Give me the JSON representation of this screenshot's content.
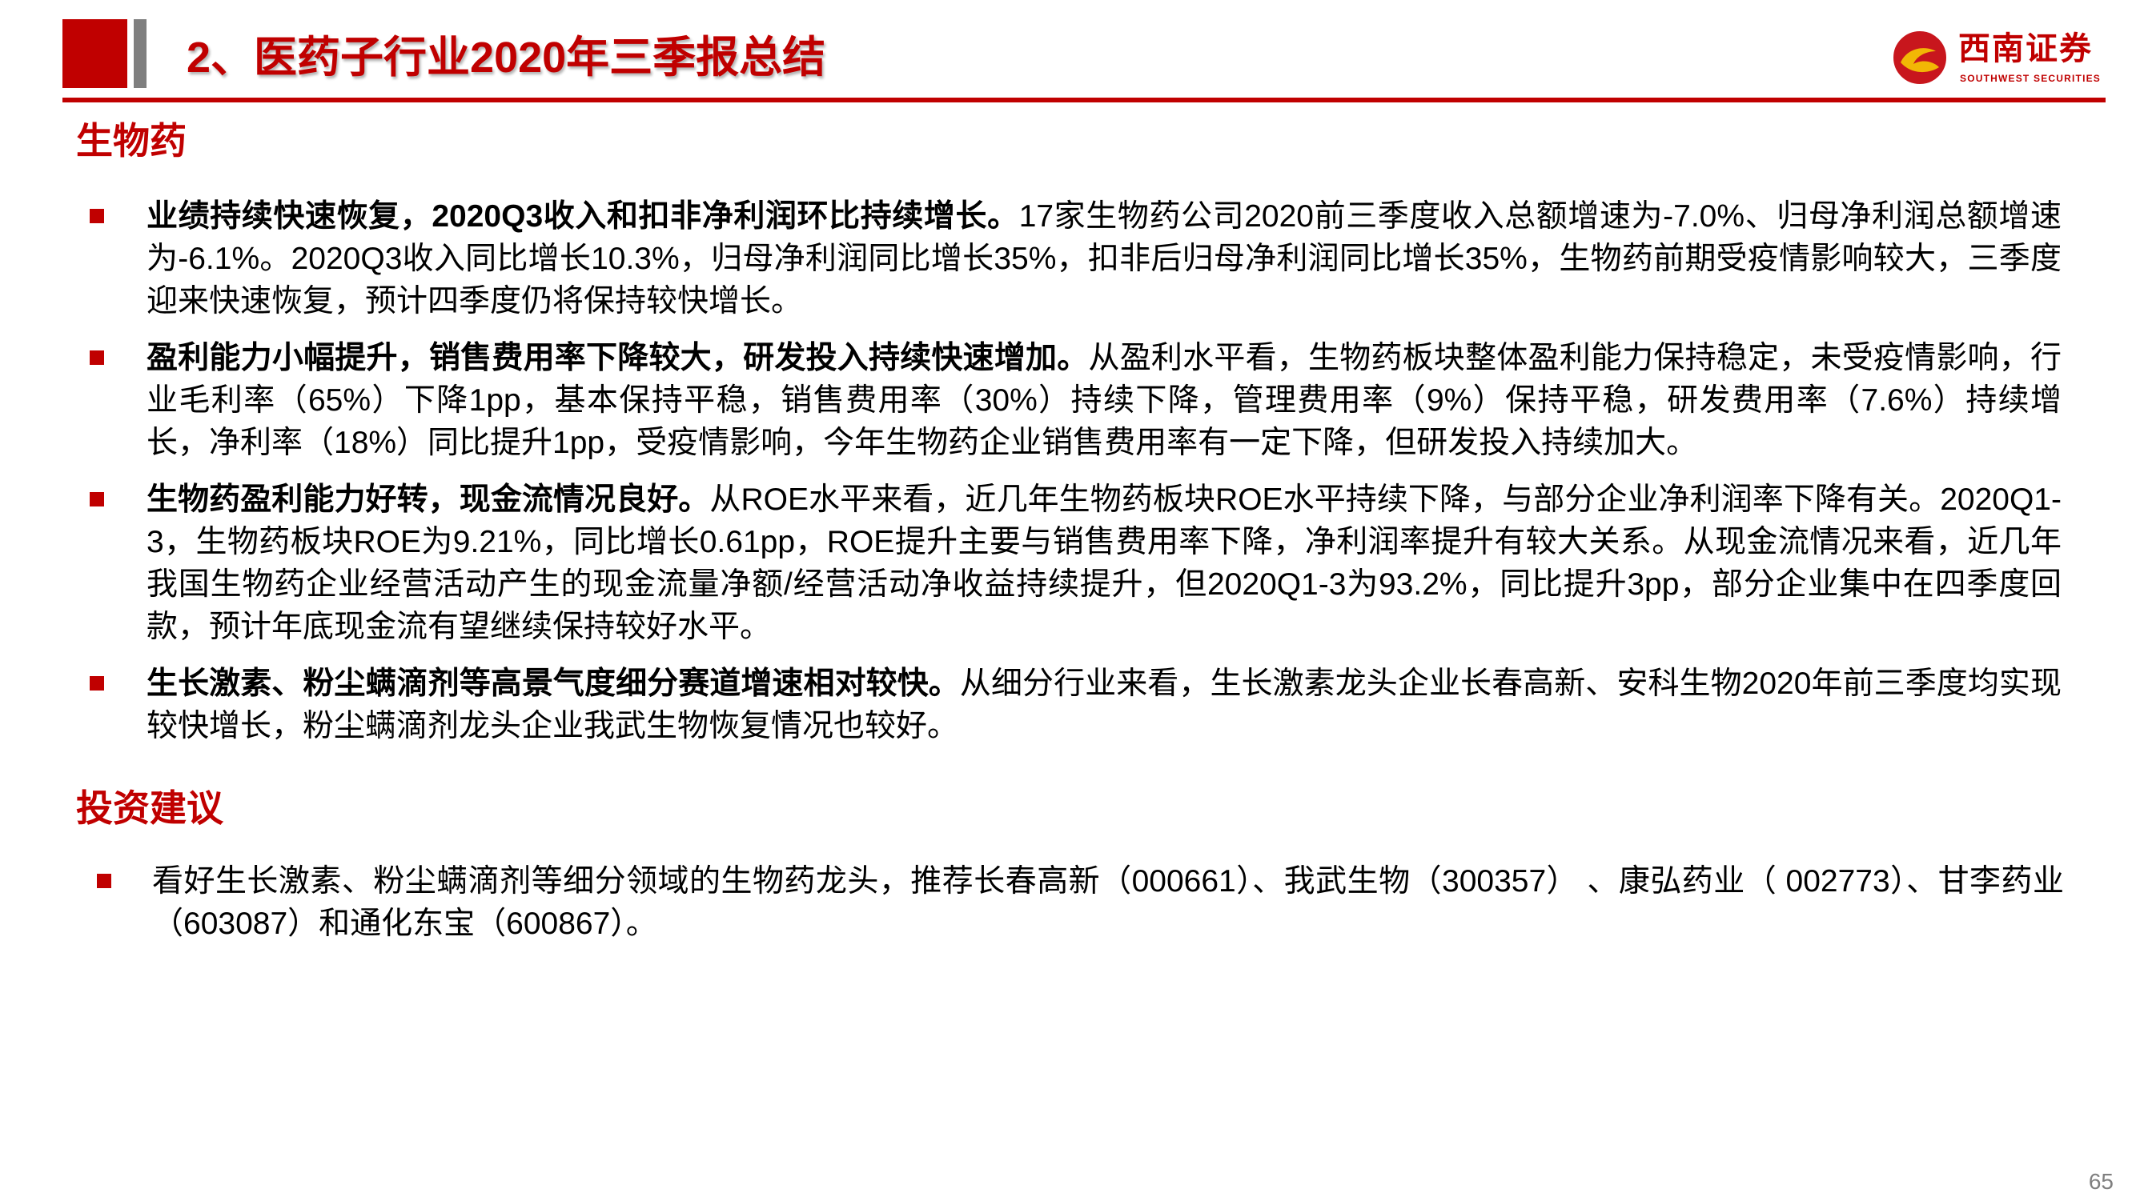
{
  "colors": {
    "accent": "#c00000",
    "muted": "#7f7f7f"
  },
  "header": {
    "title": "2、医药子行业2020年三季报总结",
    "logo": {
      "icon": "southwest-securities-logo-icon",
      "name_cn": "西南证券",
      "name_en": "SOUTHWEST SECURITIES"
    }
  },
  "sections": [
    {
      "heading": "生物药",
      "bullets": [
        {
          "lead": "业绩持续快速恢复，2020Q3收入和扣非净利润环比持续增长。",
          "body": "17家生物药公司2020前三季度收入总额增速为-7.0%、归母净利润总额增速为-6.1%。2020Q3收入同比增长10.3%，归母净利润同比增长35%，扣非后归母净利润同比增长35%，生物药前期受疫情影响较大，三季度迎来快速恢复，预计四季度仍将保持较快增长。"
        },
        {
          "lead": "盈利能力小幅提升，销售费用率下降较大，研发投入持续快速增加。",
          "body": "从盈利水平看，生物药板块整体盈利能力保持稳定，未受疫情影响，行业毛利率（65%）下降1pp，基本保持平稳，销售费用率（30%）持续下降，管理费用率（9%）保持平稳，研发费用率（7.6%）持续增长，净利率（18%）同比提升1pp，受疫情影响，今年生物药企业销售费用率有一定下降，但研发投入持续加大。"
        },
        {
          "lead": "生物药盈利能力好转，现金流情况良好。",
          "body": "从ROE水平来看，近几年生物药板块ROE水平持续下降，与部分企业净利润率下降有关。2020Q1-3，生物药板块ROE为9.21%，同比增长0.61pp，ROE提升主要与销售费用率下降，净利润率提升有较大关系。从现金流情况来看，近几年我国生物药企业经营活动产生的现金流量净额/经营活动净收益持续提升，但2020Q1-3为93.2%，同比提升3pp，部分企业集中在四季度回款，预计年底现金流有望继续保持较好水平。"
        },
        {
          "lead": "生长激素、粉尘螨滴剂等高景气度细分赛道增速相对较快。",
          "body": "从细分行业来看，生长激素龙头企业长春高新、安科生物2020年前三季度均实现较快增长，粉尘螨滴剂龙头企业我武生物恢复情况也较好。"
        }
      ]
    },
    {
      "heading": "投资建议",
      "bullets": [
        {
          "body": "看好生长激素、粉尘螨滴剂等细分领域的生物药龙头，推荐长春高新（000661）、我武生物（300357） 、康弘药业（ 002773）、甘李药业（603087）和通化东宝（600867）。"
        }
      ]
    }
  ],
  "page_number": "65"
}
